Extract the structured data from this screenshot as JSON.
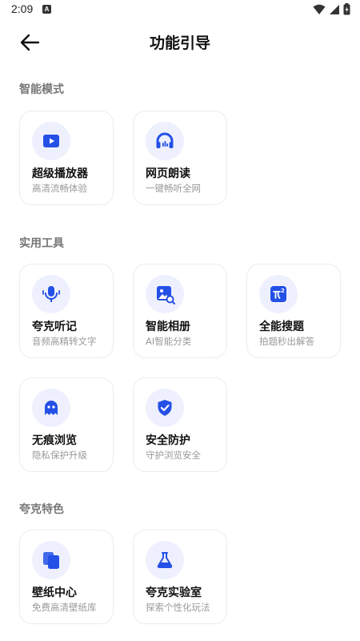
{
  "status_bar": {
    "time": "2:09",
    "notification_badge": "A"
  },
  "header": {
    "title": "功能引导"
  },
  "sections": [
    {
      "title": "智能模式",
      "items": [
        {
          "title": "超级播放器",
          "subtitle": "高清流畅体验",
          "icon": "play-icon"
        },
        {
          "title": "网页朗读",
          "subtitle": "一键畅听全网",
          "icon": "headphones-icon"
        }
      ]
    },
    {
      "title": "实用工具",
      "items": [
        {
          "title": "夸克听记",
          "subtitle": "音频高精转文字",
          "icon": "microphone-icon"
        },
        {
          "title": "智能相册",
          "subtitle": "AI智能分类",
          "icon": "photo-search-icon"
        },
        {
          "title": "全能搜题",
          "subtitle": "拍题秒出解答",
          "icon": "formula-icon"
        },
        {
          "title": "无痕浏览",
          "subtitle": "隐私保护升级",
          "icon": "ghost-icon"
        },
        {
          "title": "安全防护",
          "subtitle": "守护浏览安全",
          "icon": "shield-icon"
        }
      ]
    },
    {
      "title": "夸克特色",
      "items": [
        {
          "title": "壁纸中心",
          "subtitle": "免费高清壁纸库",
          "icon": "wallpaper-icon"
        },
        {
          "title": "夸克实验室",
          "subtitle": "探索个性化玩法",
          "icon": "flask-icon"
        }
      ]
    }
  ],
  "colors": {
    "accent": "#2450e6",
    "icon_bg": "#eef0fd",
    "card_border": "#ececf0",
    "section_title": "#777777",
    "subtitle": "#999999"
  }
}
